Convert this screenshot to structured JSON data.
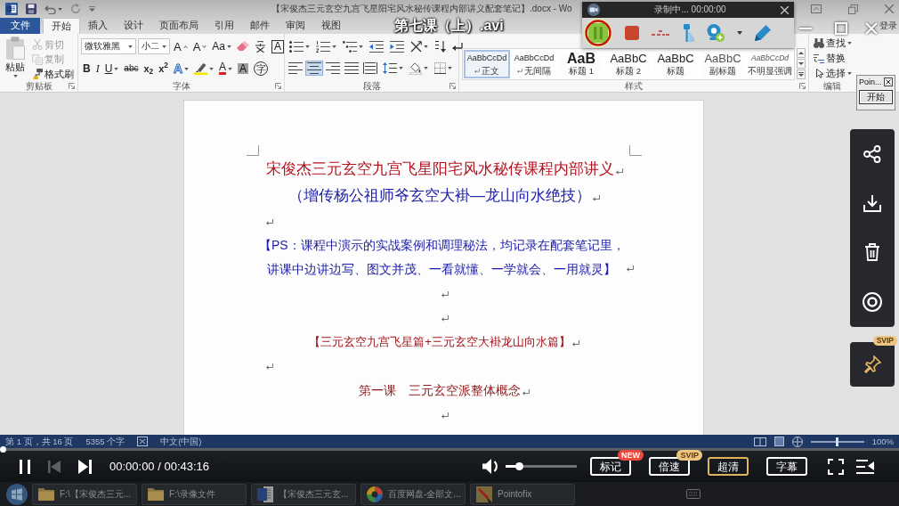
{
  "word_window": {
    "title": "【宋俊杰三元玄空九宫飞星阳宅风水秘传课程内部讲义配套笔记】.docx - Wo",
    "sign_in": "登录",
    "tabs": [
      {
        "label": "文件",
        "kind": "file",
        "selected": false
      },
      {
        "label": "开始",
        "kind": "tab",
        "selected": true
      },
      {
        "label": "插入",
        "kind": "tab",
        "selected": false
      },
      {
        "label": "设计",
        "kind": "tab",
        "selected": false
      },
      {
        "label": "页面布局",
        "kind": "tab",
        "selected": false
      },
      {
        "label": "引用",
        "kind": "tab",
        "selected": false
      },
      {
        "label": "邮件",
        "kind": "tab",
        "selected": false
      },
      {
        "label": "审阅",
        "kind": "tab",
        "selected": false
      },
      {
        "label": "视图",
        "kind": "tab",
        "selected": false
      }
    ],
    "ribbon": {
      "clipboard": {
        "label": "剪贴板",
        "launcher": true,
        "paste": "粘贴",
        "items": [
          {
            "kind": "cut",
            "label": "剪切",
            "disabled": true
          },
          {
            "kind": "copy",
            "label": "复制",
            "disabled": true
          },
          {
            "kind": "format_painter",
            "label": "格式刷",
            "disabled": false
          }
        ]
      },
      "font": {
        "label": "字体",
        "launcher": true,
        "family": "微软雅黑",
        "size": "小二",
        "row_1": [
          {
            "kind": "grow",
            "text": "A"
          },
          {
            "kind": "shrink",
            "text": "A"
          },
          {
            "kind": "case",
            "text": "Aa"
          },
          {
            "kind": "clear"
          },
          {
            "kind": "phonetic"
          },
          {
            "kind": "border",
            "text": "A"
          }
        ],
        "row_2": [
          {
            "kind": "bold",
            "text": "B"
          },
          {
            "kind": "italic",
            "text": "I"
          },
          {
            "kind": "underline",
            "text": "U"
          },
          {
            "kind": "strike",
            "text": "abc"
          },
          {
            "kind": "subscript",
            "text": "x$_{2}$"
          },
          {
            "kind": "superscript",
            "text": "x$^{2}$"
          },
          {
            "kind": "effects",
            "text": "A"
          },
          {
            "kind": "highlight"
          },
          {
            "kind": "font_color",
            "text": "A"
          },
          {
            "kind": "shading",
            "text": "A"
          },
          {
            "kind": "enclose",
            "text": "字"
          }
        ]
      },
      "paragraph": {
        "label": "段落",
        "launcher": true,
        "alignment": [
          {
            "selected": false
          },
          {
            "selected": true
          },
          {
            "selected": false
          },
          {
            "selected": false
          },
          {
            "selected": false
          }
        ]
      },
      "styles": {
        "label": "样式",
        "launcher": true,
        "items": [
          {
            "kind": "normal",
            "sample": "AaBbCcDd",
            "name": "正文",
            "paragraph_mark": true,
            "selected": true
          },
          {
            "kind": "no_spacing",
            "sample": "AaBbCcDd",
            "name": "无间隔",
            "paragraph_mark": true,
            "selected": false
          },
          {
            "kind": "heading_1",
            "sample": "AaB",
            "name": "标题 1",
            "paragraph_mark": false,
            "selected": false
          },
          {
            "kind": "heading_2",
            "sample": "AaBbC",
            "name": "标题 2",
            "paragraph_mark": false,
            "selected": false
          },
          {
            "kind": "title",
            "sample": "AaBbC",
            "name": "标题",
            "paragraph_mark": false,
            "selected": false
          },
          {
            "kind": "subtitle",
            "sample": "AaBbC",
            "name": "副标题",
            "paragraph_mark": false,
            "selected": false
          },
          {
            "kind": "subtle_emphasis",
            "sample": "AaBbCcDd",
            "name": "不明显强调",
            "paragraph_mark": false,
            "selected": false
          }
        ]
      },
      "editing": {
        "label": "编辑",
        "items": [
          {
            "kind": "find",
            "label": "查找",
            "dropdown": true
          },
          {
            "kind": "replace",
            "label": "替换",
            "dropdown": false
          },
          {
            "kind": "select",
            "label": "选择",
            "dropdown": true
          }
        ]
      }
    },
    "document": {
      "paragraphs": [
        {
          "kind": "title",
          "text": "宋俊杰三元玄空九宫飞星阳宅风水秘传课程内部讲义",
          "color": "#b3121f"
        },
        {
          "kind": "subtitle",
          "text": "（增传杨公祖师爷玄空大褂—龙山向水绝技）",
          "color": "#1c1ca6"
        },
        {
          "kind": "empty_left"
        },
        {
          "kind": "note",
          "lines": [
            "【PS：课程中演示的实战案例和调理秘法，均记录在配套笔记里，",
            "讲课中边讲边写、图文并茂、一看就懂、一学就会、一用就灵】"
          ],
          "color": "#1c1ca6"
        },
        {
          "kind": "empty_center"
        },
        {
          "kind": "empty_center"
        },
        {
          "kind": "section",
          "text": "【三元玄空九宫飞星篇+三元玄空大褂龙山向水篇】",
          "color": "#a3141c"
        },
        {
          "kind": "empty_left"
        },
        {
          "kind": "lesson",
          "text": "第一课　三元玄空派整体概念",
          "color": "#8e1a1a"
        },
        {
          "kind": "empty_center"
        }
      ]
    },
    "status_bar": {
      "page": "第 1 页，共 16 页",
      "words": "5355 个字",
      "language": "中文(中国)",
      "zoom_slider": {
        "level": 0.5
      },
      "zoom": "100%"
    }
  },
  "taskbar": {
    "items": [
      {
        "kind": "folder",
        "label": "F:\\【宋俊杰三元..."
      },
      {
        "kind": "folder",
        "label": "F:\\录像文件"
      },
      {
        "kind": "word",
        "label": "【宋俊杰三元玄..."
      },
      {
        "kind": "cloud",
        "label": "百度网盘-全部文..."
      },
      {
        "kind": "pointofix",
        "label": "Pointofix"
      }
    ]
  },
  "recorder": {
    "status": "录制中... 00:00:00",
    "pause_button": {
      "selected": true
    }
  },
  "pointofix": {
    "title": "Poin...",
    "button": "开始"
  },
  "player": {
    "title": "第七课（上）.avi",
    "progress": {
      "level": 0
    },
    "time": "00:00:00 / 00:43:16",
    "volume": {
      "level": 0.19
    },
    "buttons": [
      {
        "label": "标记",
        "badge": {
          "text": "NEW",
          "color": "#ea4a3d"
        },
        "selected": false
      },
      {
        "label": "倍速",
        "badge": {
          "text": "SVIP",
          "color": "#ecc581"
        },
        "selected": false
      },
      {
        "label": "超清",
        "selected": true
      },
      {
        "label": "字幕",
        "selected": false
      }
    ],
    "pin_badge": "SVIP"
  }
}
